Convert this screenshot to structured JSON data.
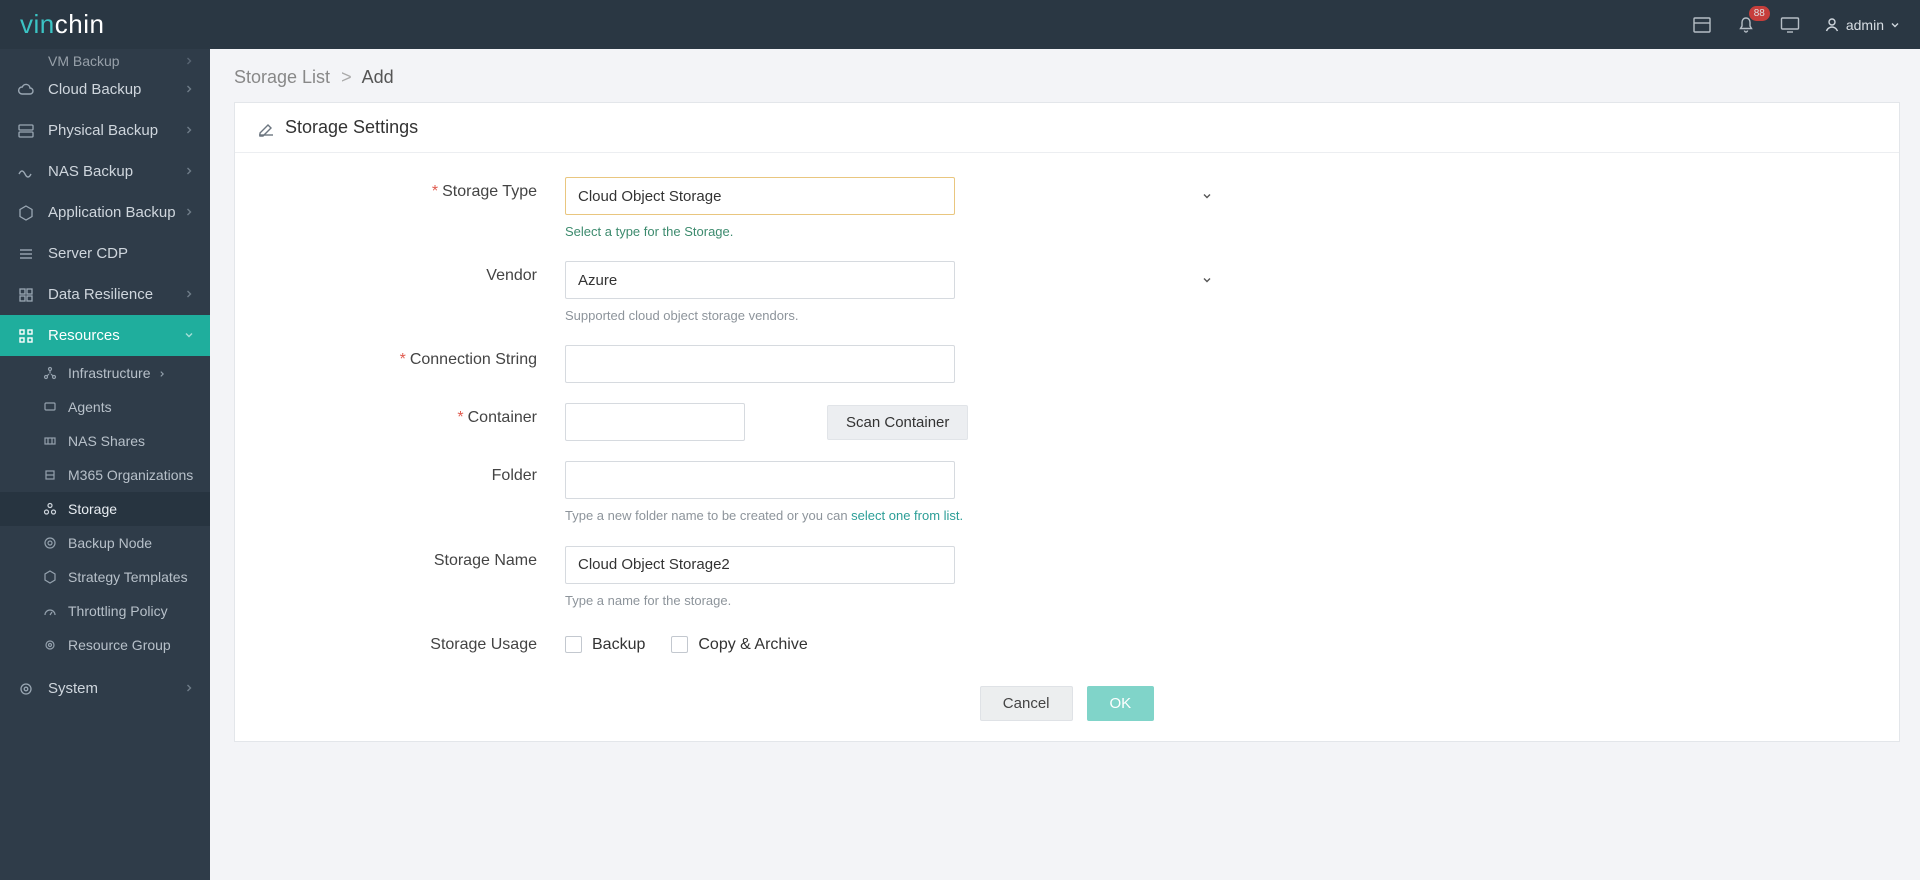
{
  "header": {
    "logo_part1": "vin",
    "logo_part2": "chin",
    "badge": "88",
    "user": "admin"
  },
  "sidebar": {
    "truncated": "VM Backup",
    "items": [
      {
        "label": "Cloud Backup",
        "icon": "cloud"
      },
      {
        "label": "Physical Backup",
        "icon": "server"
      },
      {
        "label": "NAS Backup",
        "icon": "wave"
      },
      {
        "label": "Application Backup",
        "icon": "hex"
      },
      {
        "label": "Server CDP",
        "icon": "stack"
      },
      {
        "label": "Data Resilience",
        "icon": "grid"
      }
    ],
    "active": {
      "label": "Resources",
      "icon": "apps"
    },
    "subs": [
      {
        "label": "Infrastructure",
        "chev": true
      },
      {
        "label": "Agents"
      },
      {
        "label": "NAS Shares"
      },
      {
        "label": "M365 Organizations"
      },
      {
        "label": "Storage",
        "selected": true
      },
      {
        "label": "Backup Node"
      },
      {
        "label": "Strategy Templates"
      },
      {
        "label": "Throttling Policy"
      },
      {
        "label": "Resource Group"
      }
    ],
    "system": {
      "label": "System"
    }
  },
  "breadcrumb": {
    "root": "Storage List",
    "current": "Add"
  },
  "panel": {
    "title": "Storage Settings",
    "storage_type": {
      "label": "Storage Type",
      "value": "Cloud Object Storage",
      "hint": "Select a type for the Storage."
    },
    "vendor": {
      "label": "Vendor",
      "value": "Azure",
      "hint": "Supported cloud object storage vendors."
    },
    "conn": {
      "label": "Connection String"
    },
    "container": {
      "label": "Container",
      "button": "Scan Container"
    },
    "folder": {
      "label": "Folder",
      "hint_pre": "Type a new folder name to be created or you can ",
      "link": "select one from list."
    },
    "storage_name": {
      "label": "Storage Name",
      "value": "Cloud Object Storage2",
      "hint": "Type a name for the storage."
    },
    "usage": {
      "label": "Storage Usage",
      "opt1": "Backup",
      "opt2": "Copy & Archive"
    },
    "cancel": "Cancel",
    "ok": "OK"
  }
}
